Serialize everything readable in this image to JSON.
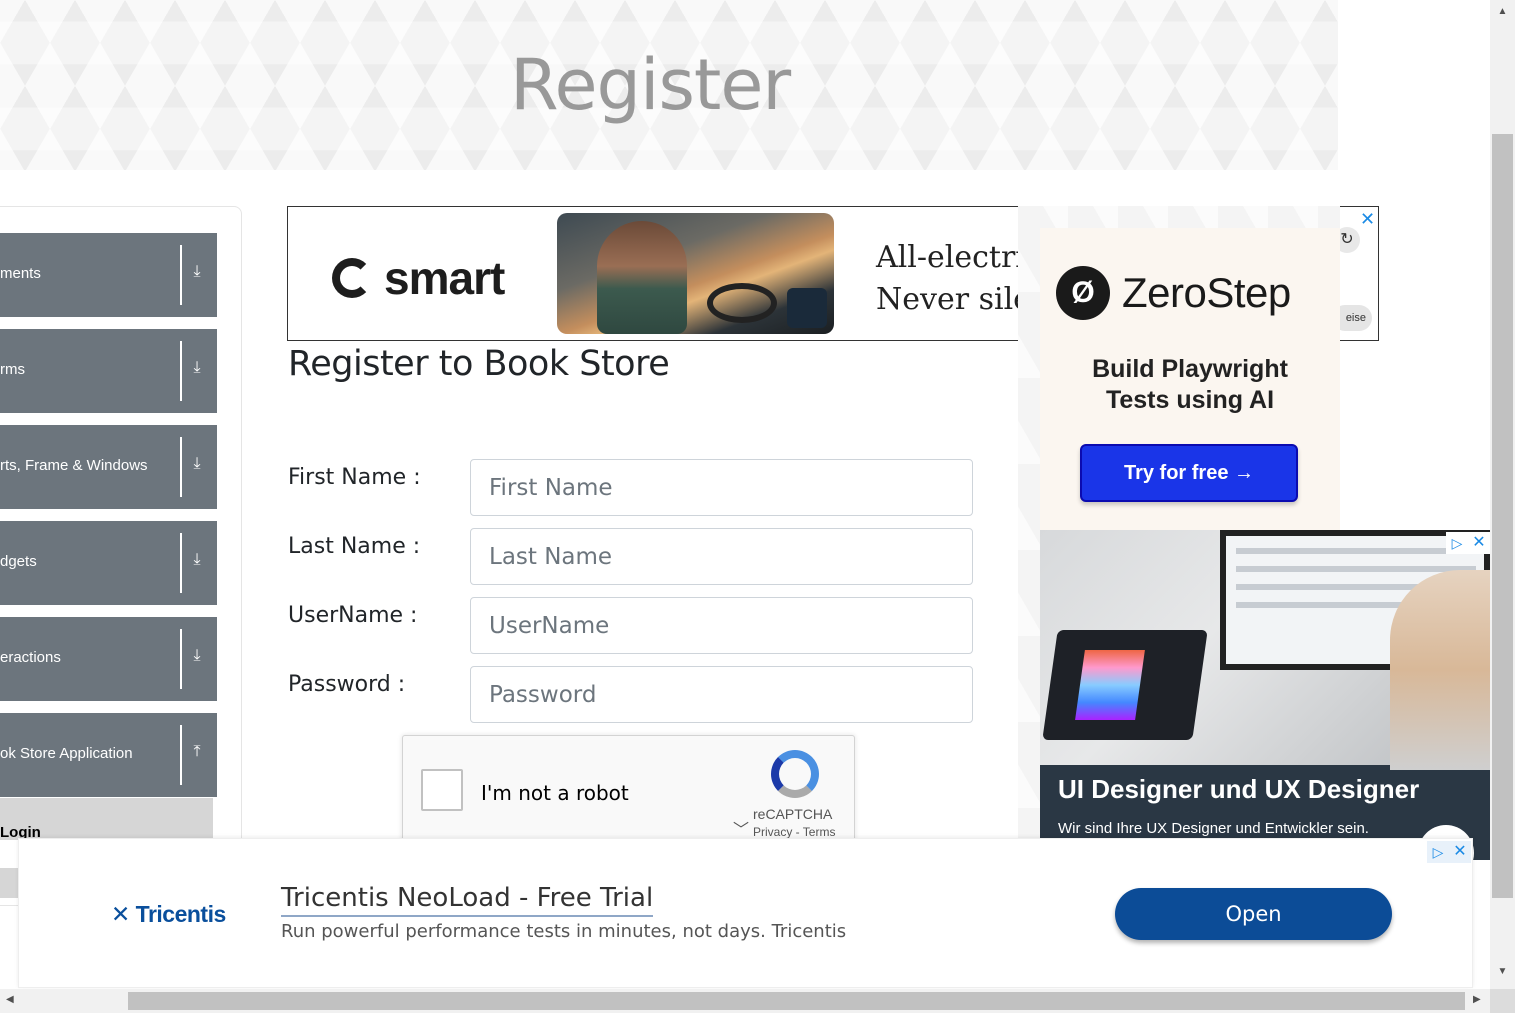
{
  "banner": {
    "title": "Register"
  },
  "sidebar": {
    "groups": [
      {
        "label": "ments",
        "icon": "⤓"
      },
      {
        "label": "rms",
        "icon": "⤓"
      },
      {
        "label": "rts, Frame & Windows",
        "icon": "⤓"
      },
      {
        "label": "dgets",
        "icon": "⤓"
      },
      {
        "label": "eractions",
        "icon": "⤓"
      },
      {
        "label": "ok Store Application",
        "icon": "⤒"
      }
    ],
    "active_item": "Login"
  },
  "top_ad": {
    "brand": "smart",
    "text_line1": "All-electric",
    "text_line2": "Never silent",
    "close": "✕",
    "replay": "↻",
    "pill": "eise"
  },
  "zerostep_ad": {
    "brand": "ZeroStep",
    "mark": "Ø",
    "tagline_line1": "Build Playwright",
    "tagline_line2": "Tests using AI",
    "button": "Try for free →"
  },
  "ux_ad": {
    "title": "UI Designer und UX Designer",
    "subtitle": "Wir sind Ihre UX Designer und Entwickler sein.",
    "flag": "▷",
    "close": "✕"
  },
  "form": {
    "title": "Register to Book Store",
    "fields": [
      {
        "label": "First Name :",
        "placeholder": "First Name",
        "value": ""
      },
      {
        "label": "Last Name :",
        "placeholder": "Last Name",
        "value": ""
      },
      {
        "label": "UserName :",
        "placeholder": "UserName",
        "value": ""
      },
      {
        "label": "Password :",
        "placeholder": "Password",
        "value": ""
      }
    ]
  },
  "captcha": {
    "label": "I'm not a robot",
    "brand": "reCAPTCHA",
    "links": "Privacy - Terms",
    "chevron": "﹀"
  },
  "bottom_ad": {
    "brand": "Tricentis",
    "title": "Tricentis NeoLoad - Free Trial",
    "description": "Run powerful performance tests in minutes, not days. Tricentis",
    "button": "Open",
    "flag": "▷",
    "close": "✕"
  },
  "scrollbars": {
    "up": "▲",
    "down": "▼",
    "left": "◀",
    "right": "▶"
  }
}
